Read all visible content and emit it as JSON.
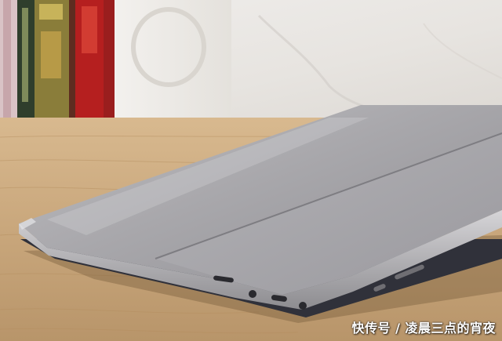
{
  "photo": {
    "subject": "laptop-closed-on-wooden-desk",
    "colors": {
      "wall": "#e9e6e2",
      "desk": "#c9a77c",
      "laptop_lid": "#a9a9ad",
      "keyboard_base": "#30313a",
      "book_red": "#b51f1f",
      "book_olive": "#8a7d3a"
    }
  },
  "watermark": {
    "text": "快传号 / 凌晨三点的宵夜"
  }
}
